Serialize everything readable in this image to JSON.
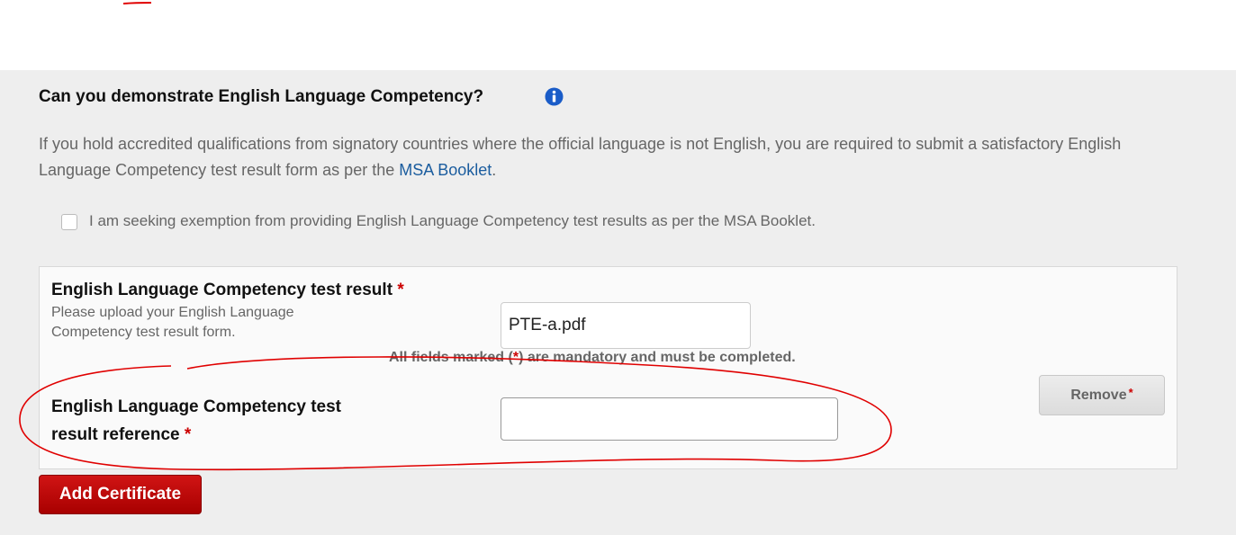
{
  "section": {
    "question": "Can you demonstrate English Language Competency?",
    "description_part1": "If you hold accredited qualifications from signatory countries where the official language is not English, you are required to submit a satisfactory English Language Competency test result form as per the ",
    "description_link": "MSA Booklet",
    "description_end": ".",
    "exemption_label": "I am seeking exemption from providing English Language Competency test results as per the MSA Booklet."
  },
  "certificate": {
    "result_label": "English Language Competency test result",
    "result_help": "Please upload your English Language Competency test result form.",
    "file_name": "PTE-a.pdf",
    "mandatory_prefix": "All fields marked (",
    "mandatory_star": "*",
    "mandatory_suffix": ") are mandatory and must be completed.",
    "reference_label_line1": "English Language Competency test",
    "reference_label_line2": "result reference",
    "reference_value": "",
    "remove_label": "Remove",
    "required_star": "*"
  },
  "actions": {
    "add_certificate_label": "Add Certificate"
  },
  "colors": {
    "panel_bg": "#eeeeee",
    "link": "#1a5c9e",
    "required": "#cc0000",
    "primary_button": "#c00000",
    "annotation": "#e00000"
  },
  "icons": {
    "info": "info-circle-icon"
  }
}
